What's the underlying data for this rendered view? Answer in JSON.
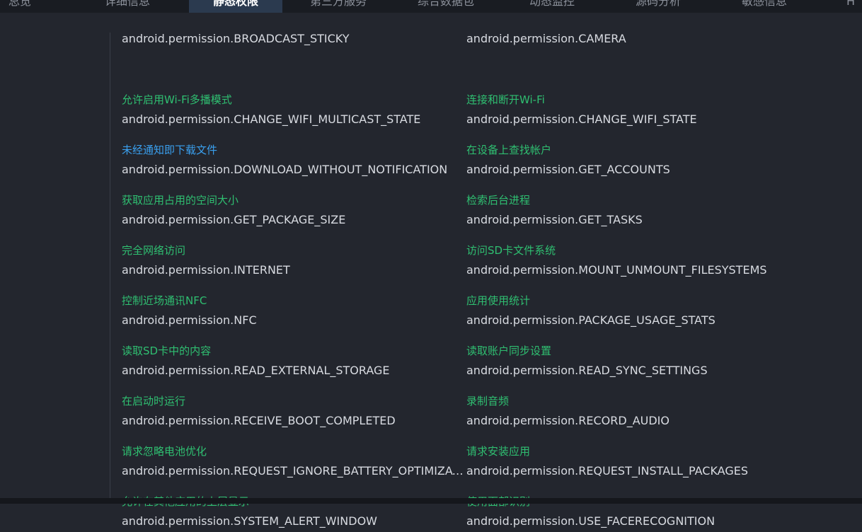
{
  "tabs": [
    {
      "label": "总览"
    },
    {
      "label": "详细信息"
    },
    {
      "label": "静态权限",
      "active": true
    },
    {
      "label": "第三方服务"
    },
    {
      "label": "综合数据包"
    },
    {
      "label": "动态监控"
    },
    {
      "label": "源码分析"
    },
    {
      "label": "敏感信息"
    },
    {
      "label": "H"
    }
  ],
  "permissions": [
    {
      "label": "",
      "name": "android.permission.BROADCAST_STICKY"
    },
    {
      "label": "",
      "name": "android.permission.CAMERA"
    },
    {
      "label": "允许启用Wi-Fi多播模式",
      "name": "android.permission.CHANGE_WIFI_MULTICAST_STATE",
      "color": "green"
    },
    {
      "label": "连接和断开Wi-Fi",
      "name": "android.permission.CHANGE_WIFI_STATE",
      "color": "green"
    },
    {
      "label": "未经通知即下载文件",
      "name": "android.permission.DOWNLOAD_WITHOUT_NOTIFICATION",
      "color": "blue"
    },
    {
      "label": "在设备上查找帐户",
      "name": "android.permission.GET_ACCOUNTS",
      "color": "green"
    },
    {
      "label": "获取应用占用的空间大小",
      "name": "android.permission.GET_PACKAGE_SIZE",
      "color": "green"
    },
    {
      "label": "检索后台进程",
      "name": "android.permission.GET_TASKS",
      "color": "green"
    },
    {
      "label": "完全网络访问",
      "name": "android.permission.INTERNET",
      "color": "green"
    },
    {
      "label": "访问SD卡文件系统",
      "name": "android.permission.MOUNT_UNMOUNT_FILESYSTEMS",
      "color": "green"
    },
    {
      "label": "控制近场通讯NFC",
      "name": "android.permission.NFC",
      "color": "green"
    },
    {
      "label": "应用使用统计",
      "name": "android.permission.PACKAGE_USAGE_STATS",
      "color": "green"
    },
    {
      "label": "读取SD卡中的内容",
      "name": "android.permission.READ_EXTERNAL_STORAGE",
      "color": "green"
    },
    {
      "label": "读取账户同步设置",
      "name": "android.permission.READ_SYNC_SETTINGS",
      "color": "green"
    },
    {
      "label": "在启动时运行",
      "name": "android.permission.RECEIVE_BOOT_COMPLETED",
      "color": "green"
    },
    {
      "label": "录制音频",
      "name": "android.permission.RECORD_AUDIO",
      "color": "green"
    },
    {
      "label": "请求忽略电池优化",
      "name": "android.permission.REQUEST_IGNORE_BATTERY_OPTIMIZATIO...",
      "color": "green"
    },
    {
      "label": "请求安装应用",
      "name": "android.permission.REQUEST_INSTALL_PACKAGES",
      "color": "green"
    },
    {
      "label": "允许在其他应用的上层显示",
      "name": "android.permission.SYSTEM_ALERT_WINDOW",
      "color": "green"
    },
    {
      "label": "使用面部识别",
      "name": "android.permission.USE_FACERECOGNITION",
      "color": "green"
    }
  ],
  "colors": {
    "green": "#2fbf71",
    "blue": "#3aa0ef",
    "text": "#d8dbe1",
    "background": "#23262e",
    "active_tab": "#2b3a4f"
  }
}
